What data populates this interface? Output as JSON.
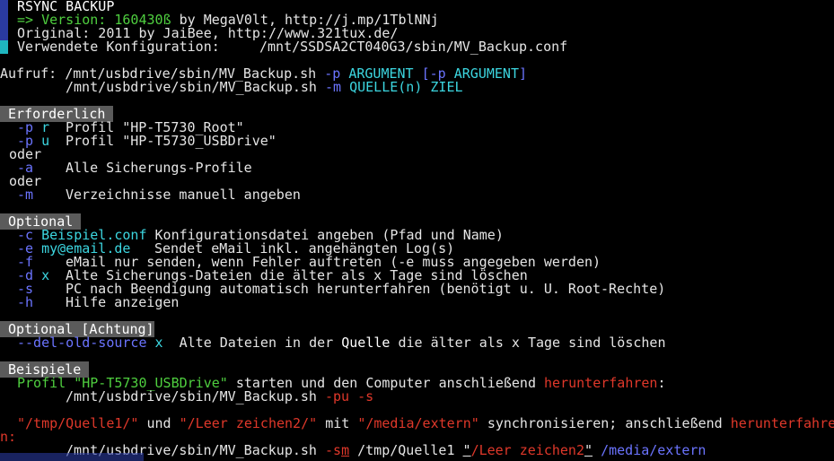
{
  "colors": {
    "green": "#4fcf3f",
    "blue": "#6b74ff",
    "cyan": "#3cd6e0",
    "red": "#e0382a",
    "header_bg": "#5b5b5b"
  },
  "banner": {
    "title": "RSYNC BACKUP",
    "version_prefix": "=> Version: 160430ß",
    "version_suffix": " by MegaV0lt, http://j.mp/1TblNNj",
    "original": "Original: 2011 by JaiBee, http://www.321tux.de/",
    "config_label": "Verwendete Konfiguration:",
    "config_path": "/mnt/SSDSA2CT040G3/sbin/MV_Backup.conf"
  },
  "usage": {
    "label": "Aufruf:",
    "line1_cmd": "/mnt/usbdrive/sbin/MV_Backup.sh",
    "line1_opt": "-p",
    "line1_arg": "ARGUMENT",
    "line1_opt2": "[-p",
    "line1_arg2": "ARGUMENT",
    "line1_close": "]",
    "line2_cmd": "/mnt/usbdrive/sbin/MV_Backup.sh",
    "line2_opt": "-m",
    "line2_arg": "QUELLE(n)",
    "line2_arg2": "ZIEL"
  },
  "required": {
    "header": "Erforderlich",
    "items": [
      {
        "flag": "-p",
        "arg": "r",
        "desc": "Profil \"HP-T5730_Root\""
      },
      {
        "flag": "-p",
        "arg": "u",
        "desc": "Profil \"HP-T5730_USBDrive\""
      },
      {
        "flag": "-a",
        "arg": "",
        "desc": "Alle Sicherungs-Profile"
      },
      {
        "flag": "-m",
        "arg": "",
        "desc": "Verzeichnisse manuell angeben"
      }
    ],
    "or": "oder"
  },
  "optional": {
    "header": "Optional",
    "items": [
      {
        "flag": "-c",
        "arg": "Beispiel.conf",
        "desc": "Konfigurationsdatei angeben (Pfad und Name)"
      },
      {
        "flag": "-e",
        "arg": "my@email.de",
        "desc": "Sendet eMail inkl. angehängten Log(s)"
      },
      {
        "flag": "-f",
        "arg": "",
        "desc": "eMail nur senden, wenn Fehler auftreten (-e muss angegeben werden)"
      },
      {
        "flag": "-d",
        "arg": "x",
        "desc": "Alte Sicherungs-Dateien die älter als x Tage sind löschen"
      },
      {
        "flag": "-s",
        "arg": "",
        "desc": "PC nach Beendigung automatisch herunterfahren (benötigt u. U. Root-Rechte)"
      },
      {
        "flag": "-h",
        "arg": "",
        "desc": "Hilfe anzeigen"
      }
    ]
  },
  "optional_warn": {
    "header": "Optional",
    "header_warn": "[Achtung]",
    "flag": "--del-old-source",
    "arg": "x",
    "desc_a": "Alte Dateien in der",
    "desc_quelle": "Quelle",
    "desc_b": "die älter als x Tage sind löschen"
  },
  "examples": {
    "header": "Beispiele",
    "ex1_a": "Profil",
    "ex1_prof": "\"HP-T5730_USBDrive\"",
    "ex1_b": "starten und den Computer anschließend",
    "ex1_red": "herunterfahren",
    "ex1_c": ":",
    "ex1_cmd": "/mnt/usbdrive/sbin/MV_Backup.sh",
    "ex1_opts": "-pu -s",
    "ex2_q1": "\"/tmp/Quelle1/\"",
    "ex2_und": "und",
    "ex2_q2": "\"/Leer zeichen2/\"",
    "ex2_mit": "mit",
    "ex2_dest": "\"/media/extern\"",
    "ex2_b": "synchronisieren; anschließend",
    "ex2_red": "herunterfahre",
    "ex2_wrap": "n:",
    "ex2_cmd": "/mnt/usbdrive/sbin/MV_Backup.sh",
    "ex2_opt": "-s",
    "ex2_optm": "m",
    "ex2_src1": "/tmp/Quelle1",
    "ex2_src2_q": "\"",
    "ex2_src2": "/Leer zeichen2",
    "ex2_src2_end": "\"",
    "ex2_dst": "/media/extern"
  }
}
